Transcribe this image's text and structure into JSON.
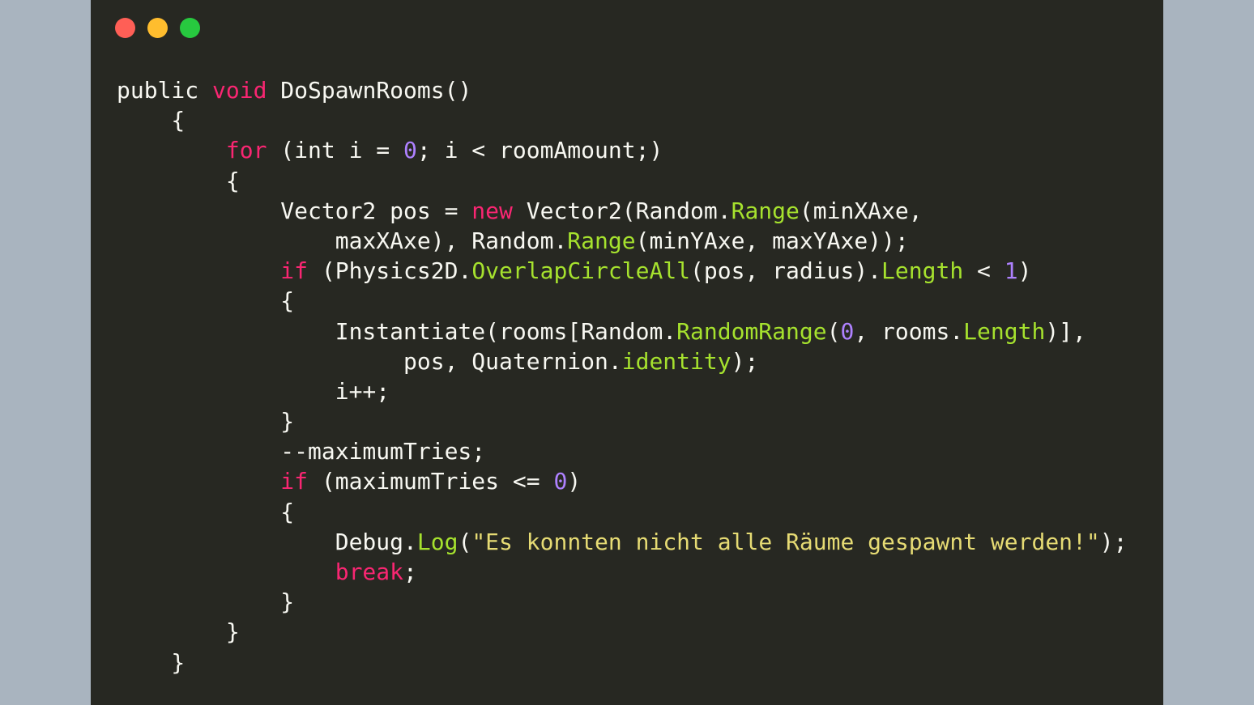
{
  "window": {
    "buttons": {
      "close_color": "#ff5f56",
      "minimize_color": "#ffbd2e",
      "maximize_color": "#27c93f"
    },
    "background": "#272822"
  },
  "theme": {
    "keyword": "#f92672",
    "member": "#a6e22e",
    "number": "#ae81ff",
    "string": "#e6db74",
    "plain": "#f8f8f2"
  },
  "code": {
    "language": "C#",
    "lines": [
      [
        {
          "t": "public ",
          "c": "pl"
        },
        {
          "t": "void",
          "c": "kw"
        },
        {
          "t": " DoSpawnRooms()",
          "c": "pl"
        }
      ],
      [
        {
          "t": "    {",
          "c": "pl"
        }
      ],
      [
        {
          "t": "        ",
          "c": "pl"
        },
        {
          "t": "for",
          "c": "kw"
        },
        {
          "t": " (int i = ",
          "c": "pl"
        },
        {
          "t": "0",
          "c": "num"
        },
        {
          "t": "; i < roomAmount;)",
          "c": "pl"
        }
      ],
      [
        {
          "t": "        {",
          "c": "pl"
        }
      ],
      [
        {
          "t": "            Vector2 pos = ",
          "c": "pl"
        },
        {
          "t": "new",
          "c": "kw"
        },
        {
          "t": " Vector2(Random.",
          "c": "pl"
        },
        {
          "t": "Range",
          "c": "fn"
        },
        {
          "t": "(minXAxe,",
          "c": "pl"
        }
      ],
      [
        {
          "t": "                maxXAxe), Random.",
          "c": "pl"
        },
        {
          "t": "Range",
          "c": "fn"
        },
        {
          "t": "(minYAxe, maxYAxe));",
          "c": "pl"
        }
      ],
      [
        {
          "t": "            ",
          "c": "pl"
        },
        {
          "t": "if",
          "c": "kw"
        },
        {
          "t": " (Physics2D.",
          "c": "pl"
        },
        {
          "t": "OverlapCircleAll",
          "c": "fn"
        },
        {
          "t": "(pos, radius).",
          "c": "pl"
        },
        {
          "t": "Length",
          "c": "fn"
        },
        {
          "t": " < ",
          "c": "pl"
        },
        {
          "t": "1",
          "c": "num"
        },
        {
          "t": ")",
          "c": "pl"
        }
      ],
      [
        {
          "t": "            {",
          "c": "pl"
        }
      ],
      [
        {
          "t": "                Instantiate(rooms[Random.",
          "c": "pl"
        },
        {
          "t": "RandomRange",
          "c": "fn"
        },
        {
          "t": "(",
          "c": "pl"
        },
        {
          "t": "0",
          "c": "num"
        },
        {
          "t": ", rooms.",
          "c": "pl"
        },
        {
          "t": "Length",
          "c": "fn"
        },
        {
          "t": ")],",
          "c": "pl"
        }
      ],
      [
        {
          "t": "                     pos, Quaternion.",
          "c": "pl"
        },
        {
          "t": "identity",
          "c": "fn"
        },
        {
          "t": ");",
          "c": "pl"
        }
      ],
      [
        {
          "t": "                i++;",
          "c": "pl"
        }
      ],
      [
        {
          "t": "            }",
          "c": "pl"
        }
      ],
      [
        {
          "t": "            --maximumTries;",
          "c": "pl"
        }
      ],
      [
        {
          "t": "            ",
          "c": "pl"
        },
        {
          "t": "if",
          "c": "kw"
        },
        {
          "t": " (maximumTries <= ",
          "c": "pl"
        },
        {
          "t": "0",
          "c": "num"
        },
        {
          "t": ")",
          "c": "pl"
        }
      ],
      [
        {
          "t": "            {",
          "c": "pl"
        }
      ],
      [
        {
          "t": "                Debug.",
          "c": "pl"
        },
        {
          "t": "Log",
          "c": "fn"
        },
        {
          "t": "(",
          "c": "pl"
        },
        {
          "t": "\"Es konnten nicht alle Räume gespawnt werden!\"",
          "c": "str"
        },
        {
          "t": ");",
          "c": "pl"
        }
      ],
      [
        {
          "t": "                ",
          "c": "pl"
        },
        {
          "t": "break",
          "c": "kw"
        },
        {
          "t": ";",
          "c": "pl"
        }
      ],
      [
        {
          "t": "            }",
          "c": "pl"
        }
      ],
      [
        {
          "t": "        }",
          "c": "pl"
        }
      ],
      [
        {
          "t": "    }",
          "c": "pl"
        }
      ]
    ]
  }
}
